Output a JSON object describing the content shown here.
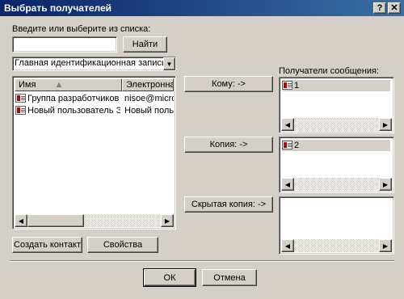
{
  "window": {
    "title": "Выбрать получателей",
    "help": "?",
    "close": "✕"
  },
  "search": {
    "label": "Введите или выберите из списка:",
    "value": "",
    "find_button": "Найти"
  },
  "address_book": {
    "selected": "Главная идентификационная запись кон"
  },
  "contacts": {
    "columns": [
      "Имя",
      "Электронная"
    ],
    "rows": [
      {
        "name": "Группа разработчиков ...",
        "email": "nisoe@micros"
      },
      {
        "name": "Новый пользователь Э...",
        "email": "Новый польз"
      }
    ]
  },
  "buttons": {
    "to": "Кому: ->",
    "cc": "Копия: ->",
    "bcc": "Скрытая копия: ->",
    "new_contact": "Создать контакт",
    "properties": "Свойства",
    "ok": "ОК",
    "cancel": "Отмена"
  },
  "recipients": {
    "label": "Получатели сообщения:",
    "to_items": [
      "1"
    ],
    "cc_items": [
      "2"
    ],
    "bcc_items": []
  }
}
